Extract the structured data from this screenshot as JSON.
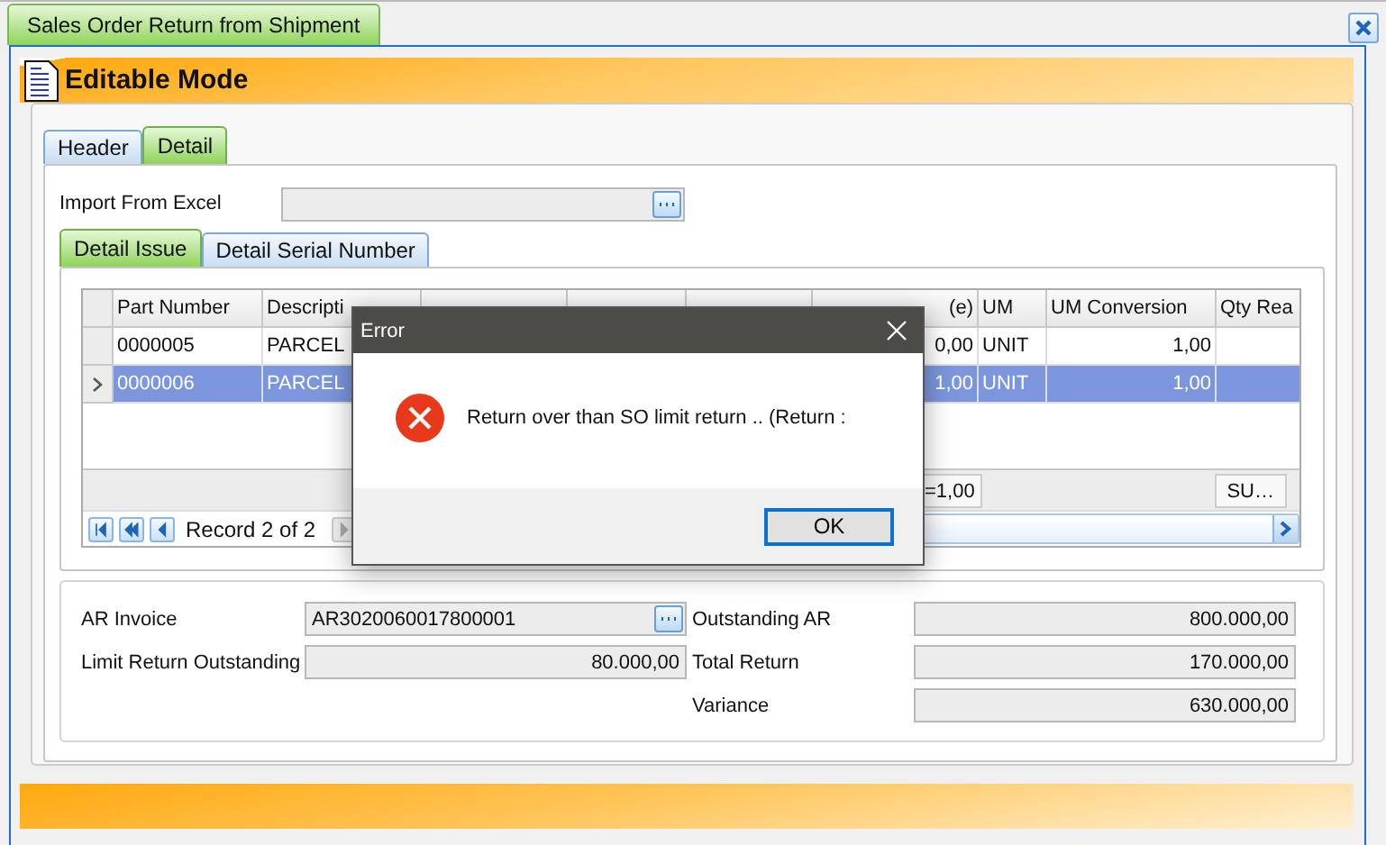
{
  "window_tab": {
    "label": "Sales Order Return from Shipment",
    "selected": true
  },
  "mode_title": "Editable Mode",
  "tabs": [
    {
      "label": "Header",
      "selected": false
    },
    {
      "label": "Detail",
      "selected": true
    }
  ],
  "import_field": {
    "label": "Import From Excel"
  },
  "detail_tabs": [
    {
      "label": "Detail Issue",
      "selected": true
    },
    {
      "label": "Detail Serial Number",
      "selected": false
    }
  ],
  "grid": {
    "columns": [
      {
        "label": "Part Number"
      },
      {
        "label": "Descripti"
      },
      {},
      {},
      {},
      {
        "label": "(e)"
      },
      {
        "label": "UM"
      },
      {
        "label": "UM Conversion"
      },
      {
        "label": "Qty Rea"
      }
    ],
    "rows": [
      {
        "selected": false,
        "part_number": "0000005",
        "description": "PARCEL",
        "qty": "0,00",
        "um": "UNIT",
        "um_conversion": "1,00"
      },
      {
        "selected": true,
        "part_number": "0000006",
        "description": "PARCEL",
        "qty": "1,00",
        "um": "UNIT",
        "um_conversion": "1,00"
      }
    ],
    "footer": {
      "sum": "=1,00",
      "summary": "SU…"
    },
    "navigator": {
      "record": "Record 2 of 2"
    }
  },
  "totals": {
    "left": [
      {
        "label": "AR Invoice",
        "value": "AR3020060017800001",
        "kind": "lookup"
      },
      {
        "label": "Limit Return Outstanding",
        "value": "80.000,00",
        "kind": "amount"
      }
    ],
    "right": [
      {
        "label": "Outstanding AR",
        "value": "800.000,00",
        "kind": "amount"
      },
      {
        "label": "Total Return",
        "value": "170.000,00",
        "kind": "amount"
      },
      {
        "label": "Variance",
        "value": "630.000,00",
        "kind": "amount"
      }
    ]
  },
  "dialog": {
    "title": "Error",
    "message": "Return over than SO limit return .. (Return :",
    "button": "OK"
  }
}
